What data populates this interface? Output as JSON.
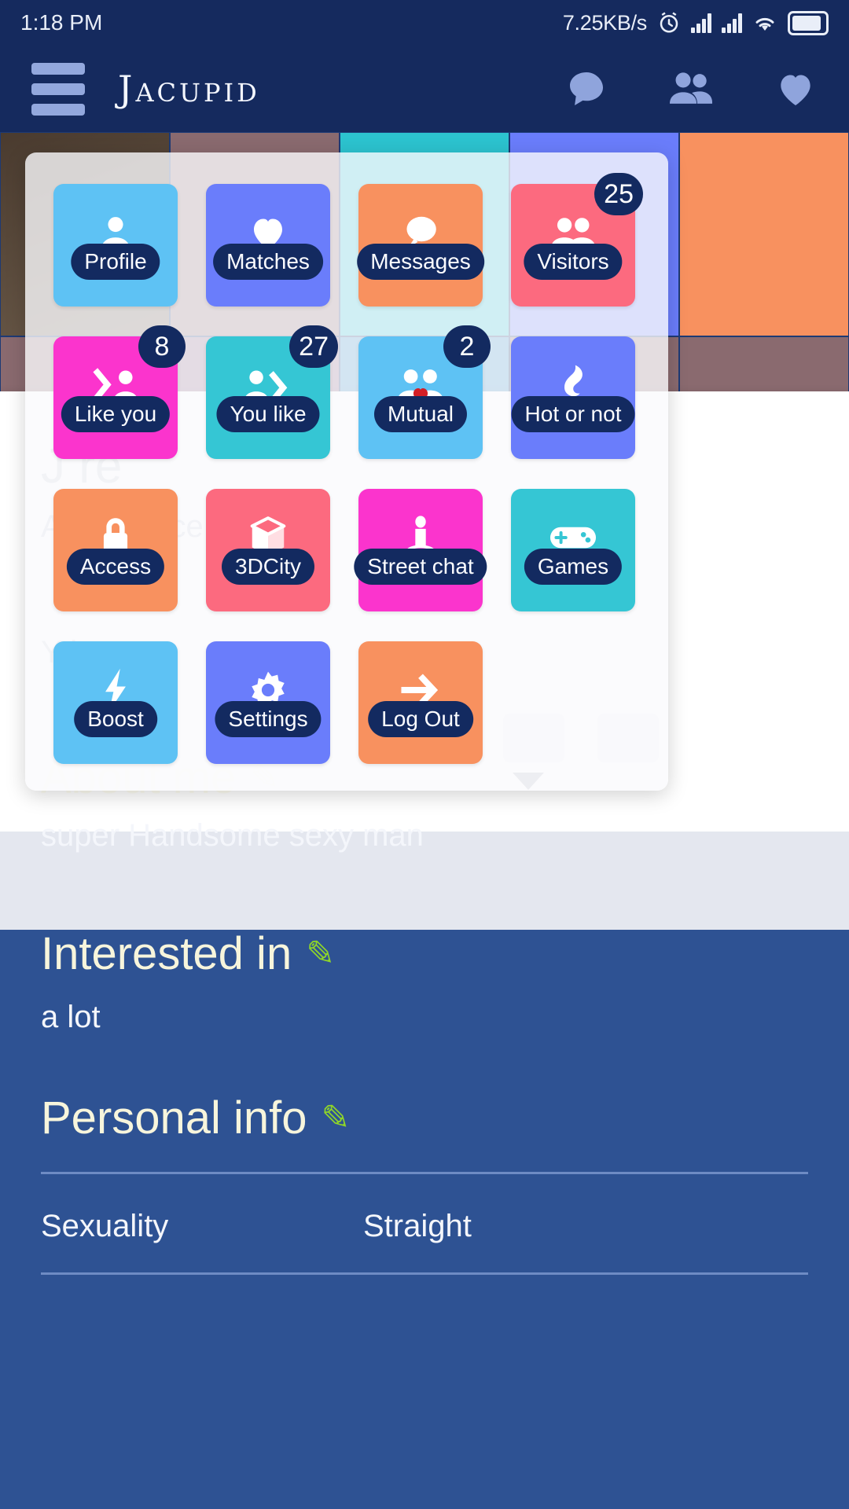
{
  "status_bar": {
    "time": "1:18 PM",
    "network_speed": "7.25KB/s",
    "icons": [
      "alarm-clock-icon",
      "signal-bars-icon",
      "signal-bars-icon",
      "wifi-icon",
      "battery-icon"
    ]
  },
  "app_bar": {
    "menu_icon": "hamburger-menu-icon",
    "brand": "Jacupid",
    "actions": [
      {
        "name": "chat-bubble-icon",
        "label": "Chat"
      },
      {
        "name": "people-icon",
        "label": "People"
      },
      {
        "name": "heart-icon",
        "label": "Favorites"
      }
    ]
  },
  "drawer": {
    "tiles": [
      {
        "label": "Profile",
        "icon": "person-icon",
        "color": "#5ec2f4",
        "badge": null
      },
      {
        "label": "Matches",
        "icon": "heart-icon",
        "color": "#6a7dfb",
        "badge": null
      },
      {
        "label": "Messages",
        "icon": "speech-bubble-icon",
        "color": "#f8915f",
        "badge": null
      },
      {
        "label": "Visitors",
        "icon": "people-icon",
        "color": "#fc6a7f",
        "badge": "25"
      },
      {
        "label": "Like you",
        "icon": "arrow-to-person-icon",
        "color": "#fb34cd",
        "badge": "8"
      },
      {
        "label": "You like",
        "icon": "person-to-arrow-icon",
        "color": "#35c6d4",
        "badge": "27"
      },
      {
        "label": "Mutual",
        "icon": "two-people-heart-icon",
        "color": "#5ec2f4",
        "badge": "2"
      },
      {
        "label": "Hot or not",
        "icon": "flame-icon",
        "color": "#6a7dfb",
        "badge": null
      },
      {
        "label": "Access",
        "icon": "lock-icon",
        "color": "#f8915f",
        "badge": null
      },
      {
        "label": "3DCity",
        "icon": "cube-icon",
        "color": "#fc6a7f",
        "badge": null
      },
      {
        "label": "Street chat",
        "icon": "avatar-stand-icon",
        "color": "#fb34cd",
        "badge": null
      },
      {
        "label": "Games",
        "icon": "gamepad-icon",
        "color": "#35c6d4",
        "badge": null
      },
      {
        "label": "Boost",
        "icon": "lightning-bolt-icon",
        "color": "#5ec2f4",
        "badge": null
      },
      {
        "label": "Settings",
        "icon": "gear-icon",
        "color": "#6a7dfb",
        "badge": null
      },
      {
        "label": "Log Out",
        "icon": "arrow-right-icon",
        "color": "#f8915f",
        "badge": null
      }
    ]
  },
  "background_profile": {
    "name": "J        re",
    "location": "Agua Dulce",
    "line3": "Y                he"
  },
  "profile": {
    "about_title": "About me",
    "about_text": "super Handsome sexy man",
    "interested_title": "Interested in",
    "interested_text": "a lot",
    "personal_title": "Personal info",
    "edit_icon": "pencil-icon",
    "rows": [
      {
        "key": "Sexuality",
        "value": "Straight"
      }
    ]
  },
  "colors": {
    "app_bar": "#152a5e",
    "page_bg": "#2e5293",
    "label_pill": "#132a60",
    "heading": "#f7f5dc",
    "pencil": "#8ed42a"
  }
}
